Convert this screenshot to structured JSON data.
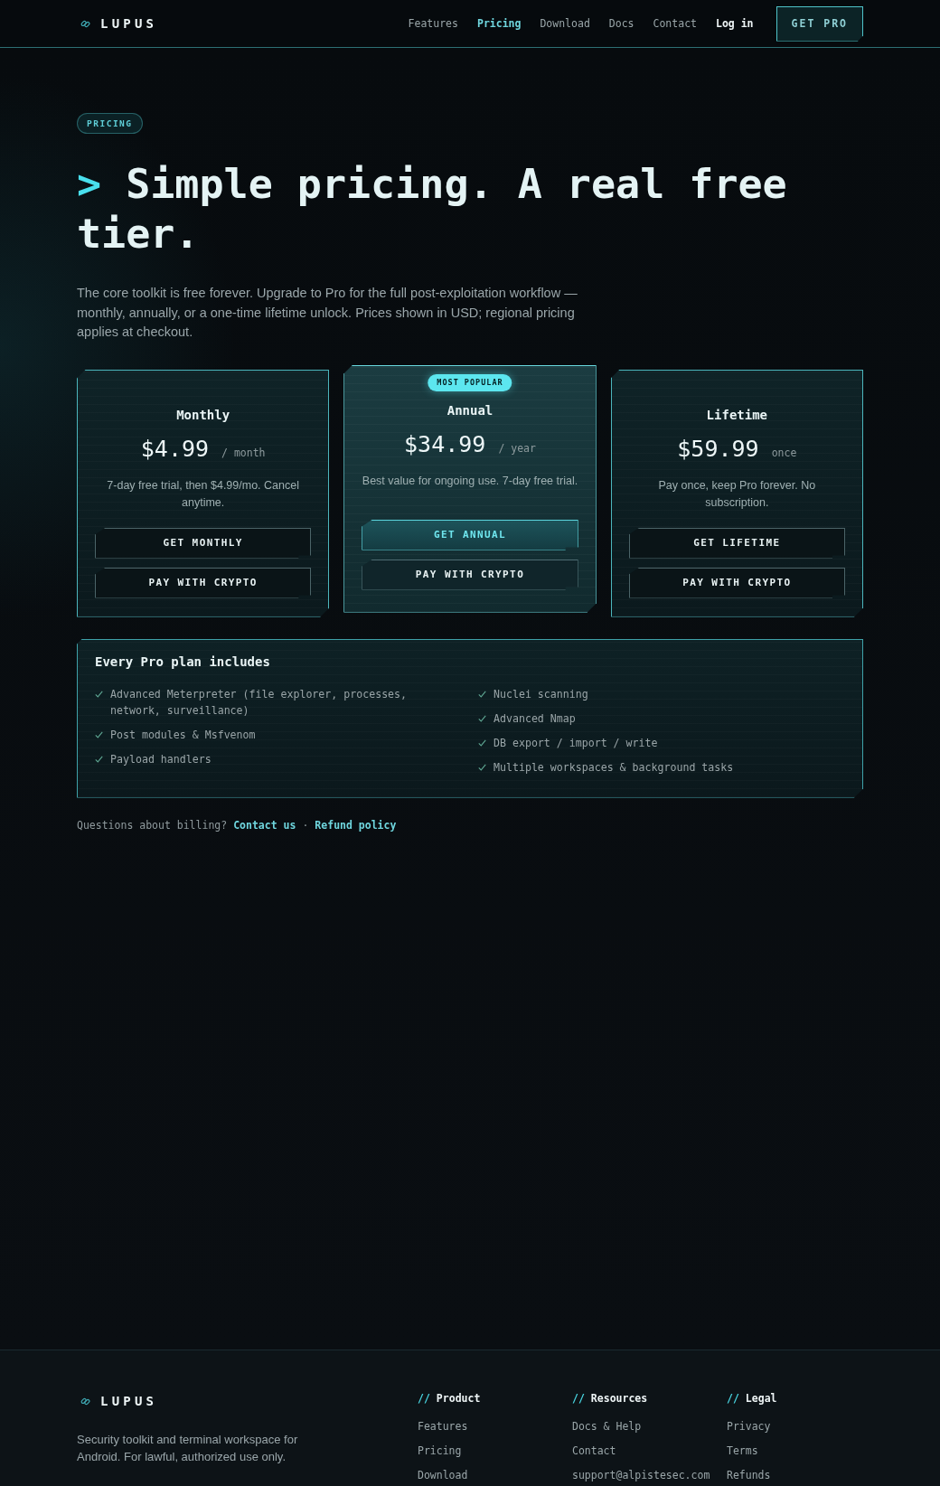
{
  "header": {
    "logo": "LUPUS",
    "nav": [
      {
        "label": "Features",
        "selected": false
      },
      {
        "label": "Pricing",
        "selected": true
      },
      {
        "label": "Download",
        "selected": false
      },
      {
        "label": "Docs",
        "selected": false
      },
      {
        "label": "Contact",
        "selected": false
      }
    ],
    "login": "Log in",
    "cta": "GET PRO"
  },
  "hero": {
    "badge": "PRICING",
    "prompt": ">",
    "title": "Simple pricing. A real free tier.",
    "intro": "The core toolkit is free forever. Upgrade to Pro for the full post-exploitation workflow — monthly, annually, or a one-time lifetime unlock. Prices shown in USD; regional pricing applies at checkout."
  },
  "plans": [
    {
      "name": "Monthly",
      "featured": false,
      "price": "$4.99",
      "period": "/ month",
      "description": "7-day free trial, then $4.99/mo. Cancel anytime.",
      "buttons": [
        "GET MONTHLY",
        "PAY WITH CRYPTO"
      ]
    },
    {
      "name": "Annual",
      "featured": true,
      "badge": "MOST POPULAR",
      "price": "$34.99",
      "period": "/ year",
      "description": "Best value for ongoing use. 7-day free trial.",
      "buttons": [
        "GET ANNUAL",
        "PAY WITH CRYPTO"
      ]
    },
    {
      "name": "Lifetime",
      "featured": false,
      "price": "$59.99",
      "period": "once",
      "description": "Pay once, keep Pro forever. No subscription.",
      "buttons": [
        "GET LIFETIME",
        "PAY WITH CRYPTO"
      ]
    }
  ],
  "includes": {
    "title": "Every Pro plan includes",
    "columns": [
      [
        "Advanced Meterpreter (file explorer, processes, network, surveillance)",
        "Post modules & Msfvenom",
        "Payload handlers"
      ],
      [
        "Nuclei scanning",
        "Advanced Nmap",
        "DB export / import / write",
        "Multiple workspaces & background tasks"
      ]
    ]
  },
  "billing": {
    "question": "Questions about billing?",
    "links": [
      "Contact us",
      "Refund policy"
    ],
    "separator": "·"
  },
  "footer": {
    "logo": "LUPUS",
    "tagline": "Security toolkit and terminal workspace for Android. For lawful, authorized use only.",
    "columns": [
      {
        "prefix": "//",
        "title": "Product",
        "links": [
          "Features",
          "Pricing",
          "Download"
        ]
      },
      {
        "prefix": "//",
        "title": "Resources",
        "links": [
          "Docs & Help",
          "Contact",
          "support@alpistesec.com"
        ]
      },
      {
        "prefix": "//",
        "title": "Legal",
        "links": [
          "Privacy",
          "Terms",
          "Refunds"
        ]
      }
    ]
  }
}
